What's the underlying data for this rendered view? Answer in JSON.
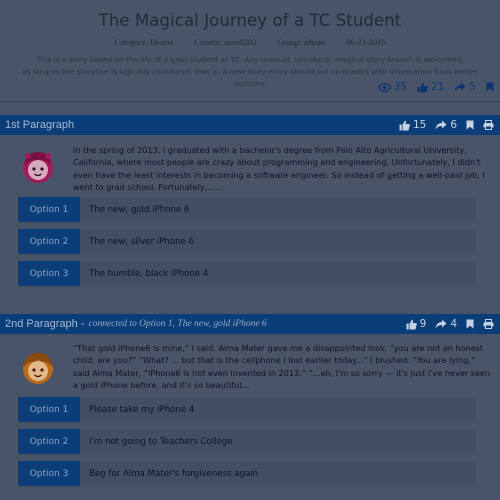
{
  "story": {
    "title": "The Magical Journey of a TC Student",
    "category": "Category: Drama",
    "creator": "Creator: soso0202",
    "group": "Group: admin",
    "date": "06-23-2015",
    "description_line1": "This is a story based on the life of a grad student at TC. Any unusual, unnatural, magical story branch is welcomed,",
    "description_line2": "as long as the storyline is logically consistent, that is, a new story entry should not contradict with information from earlier sections.",
    "views": "35",
    "likes": "21",
    "shares": "5"
  },
  "paragraphs": [
    {
      "title": "1st Paragraph",
      "connected": "",
      "likes": "15",
      "shares": "6",
      "text": "In the spring of 2013, I graduated with a bachelor's degree from Palo Alto Agricultural University, California, where most people are crazy about programming and engineering. Unfortunately, I didn't even have the least interests in becoming a software engineer. So instead of getting a well-paid job, I went to grad school. Fortunately,......",
      "options": [
        {
          "tag": "Option 1",
          "text": "The new, gold iPhone 6"
        },
        {
          "tag": "Option 2",
          "text": "The new, silver iPhone 6"
        },
        {
          "tag": "Option 3",
          "text": "The humble, black iPhone 4"
        }
      ]
    },
    {
      "title": "2nd Paragraph -",
      "connected": "connected to Option 1, The new, gold iPhone 6",
      "likes": "9",
      "shares": "4",
      "text": "“That gold iPhone6 is mine,” I said. Alma Mater gave me a disappointed look. “you are not an honest child, are you?” “What? ... but that is the cellphone I lost earlier today...” I blushed. “You are lying,” said Alma Mater, “iPhone6 is not even invented in 2013.” “...ah, I'm so sorry — it's just I've never seen a gold iPhone before, and it's so beautiful...",
      "options": [
        {
          "tag": "Option 1",
          "text": "Please take my iPhone 4"
        },
        {
          "tag": "Option 2",
          "text": "I'm not going to Teachers College"
        },
        {
          "tag": "Option 3",
          "text": "Beg for Alma Mater's forgiveness again"
        }
      ]
    }
  ],
  "colors": {
    "background": "#4a5468",
    "bar": "#0b3d78",
    "avatar_girl": "#a11a5a",
    "avatar_boy": "#b8691c"
  },
  "icons": {
    "views": "eye-icon",
    "likes": "thumbs-up-icon",
    "shares": "share-icon",
    "bookmark": "bookmark-icon",
    "print": "print-icon"
  }
}
